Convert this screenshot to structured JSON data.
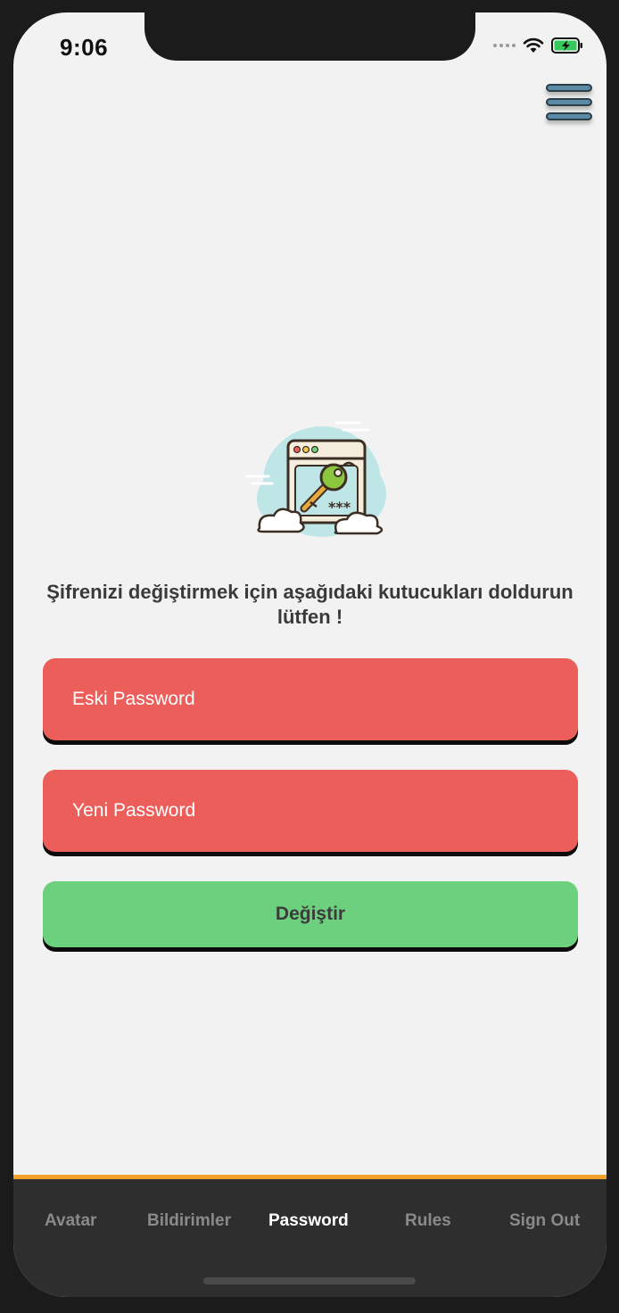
{
  "status_bar": {
    "time": "9:06"
  },
  "header": {
    "menu_icon": "hamburger-menu-icon"
  },
  "illustration": {
    "icon": "password-key-window-icon",
    "masked_text": "***"
  },
  "form": {
    "instruction": "Şifrenizi değiştirmek için aşağıdaki kutucukları doldurun lütfen !",
    "old_password_placeholder": "Eski Password",
    "new_password_placeholder": "Yeni Password",
    "submit_label": "Değiştir"
  },
  "tab_bar": {
    "tabs": [
      {
        "label": "Avatar",
        "active": false
      },
      {
        "label": "Bildirimler",
        "active": false
      },
      {
        "label": "Password",
        "active": true
      },
      {
        "label": "Rules",
        "active": false
      },
      {
        "label": "Sign Out",
        "active": false
      }
    ]
  },
  "colors": {
    "field_bg": "#ec5e5a",
    "button_bg": "#6cd17f",
    "tab_accent": "#f0a22c",
    "tabbar_bg": "#2e2e2f",
    "screen_bg": "#f2f2f2"
  }
}
